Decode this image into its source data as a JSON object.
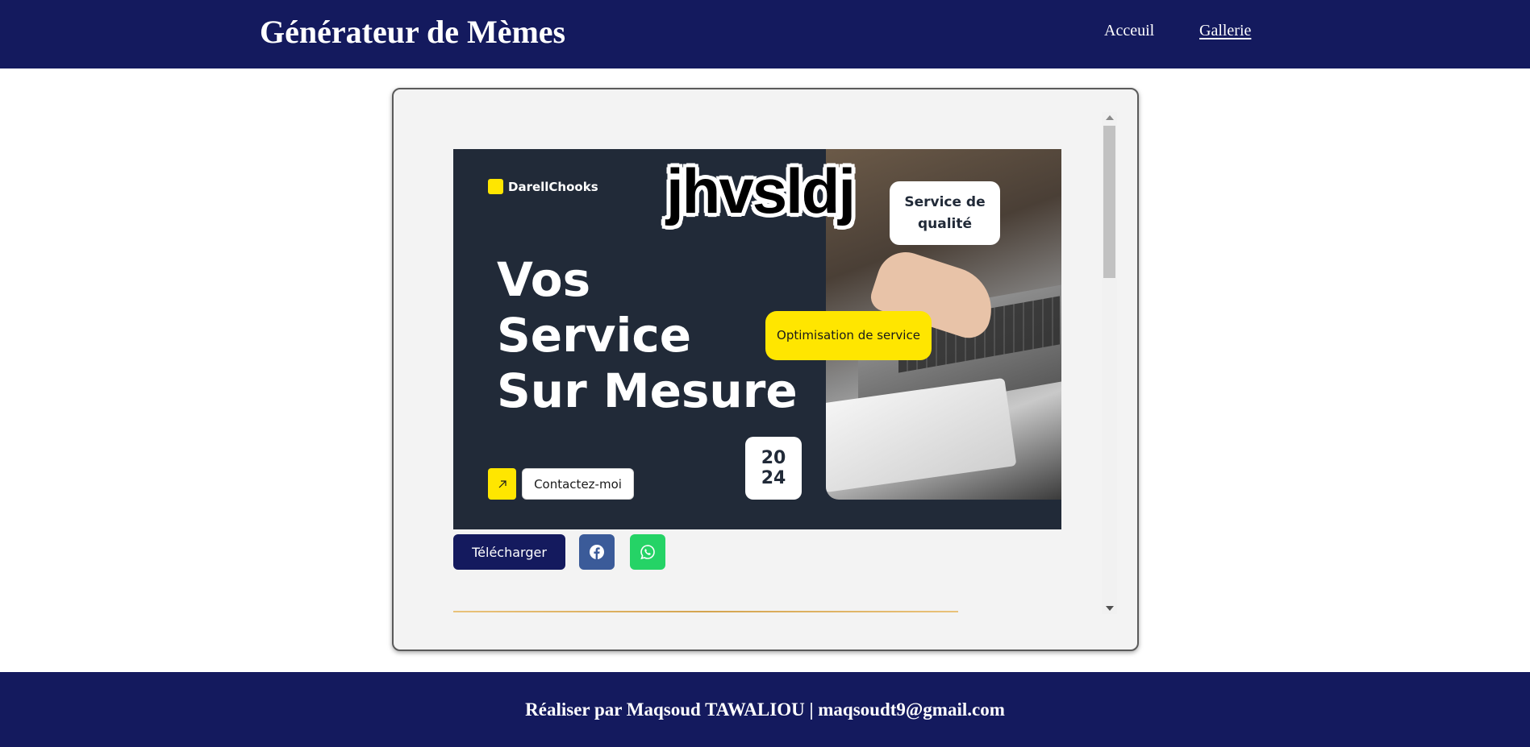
{
  "header": {
    "title": "Générateur de Mèmes",
    "nav": [
      {
        "label": "Acceuil",
        "active": false
      },
      {
        "label": "Gallerie",
        "active": true
      }
    ],
    "background": "#141a5e"
  },
  "gallery": {
    "meme": {
      "caption": "jhvsldj",
      "template": {
        "brand": "DarellChooks",
        "headline": [
          "Vos",
          "Service",
          "Sur Mesure"
        ],
        "badge": "Service de qualité",
        "pill": "Optimisation de service",
        "year": [
          "20",
          "24"
        ],
        "cta": "Contactez-moi",
        "cta_icon": "arrow-up-right-icon",
        "accent": "#ffe600",
        "background": "#212a38"
      }
    },
    "actions": {
      "download_label": "Télécharger",
      "share": [
        {
          "name": "facebook",
          "icon": "facebook-icon",
          "color": "#3b5b99"
        },
        {
          "name": "whatsapp",
          "icon": "whatsapp-icon",
          "color": "#25d366"
        }
      ]
    }
  },
  "footer": {
    "text": "Réaliser par Maqsoud TAWALIOU | maqsoudt9@gmail.com"
  }
}
